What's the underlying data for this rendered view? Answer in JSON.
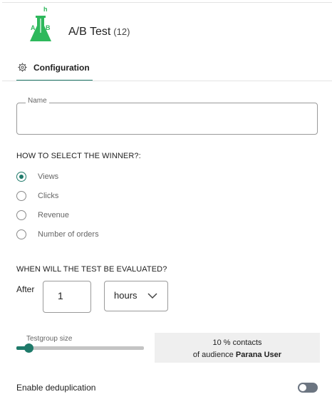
{
  "header": {
    "logo_text": "h",
    "title": "A/B Test",
    "count": "(12)",
    "brand_color": "#2eb85c"
  },
  "tabs": [
    {
      "label": "Configuration",
      "icon": "gear-icon",
      "active": true
    }
  ],
  "name_field": {
    "label": "Name",
    "value": ""
  },
  "winner": {
    "heading": "HOW TO SELECT THE WINNER?:",
    "options": [
      {
        "label": "Views",
        "checked": true
      },
      {
        "label": "Clicks",
        "checked": false
      },
      {
        "label": "Revenue",
        "checked": false
      },
      {
        "label": "Number of orders",
        "checked": false
      }
    ]
  },
  "evaluation": {
    "heading": "WHEN WILL THE TEST BE EVALUATED?",
    "after_label": "After",
    "amount": "1",
    "unit": "hours"
  },
  "testgroup": {
    "label": "Testgroup size",
    "value_percent": 10,
    "info_line1": "10 % contacts",
    "info_line2_prefix": "of audience ",
    "audience": "Parana User"
  },
  "dedup": {
    "label": "Enable deduplication",
    "enabled": false
  },
  "colors": {
    "accent": "#1f7a6a",
    "toggle_off": "#6c7581"
  }
}
